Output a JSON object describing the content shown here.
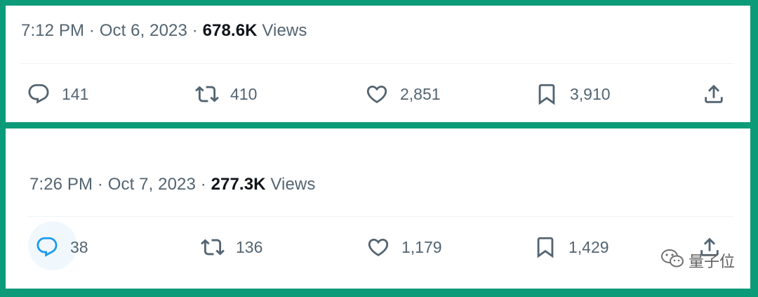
{
  "tweets": [
    {
      "time": "7:12 PM",
      "date": "Oct 6, 2023",
      "views_count": "678.6K",
      "views_label": "Views",
      "separator": "·",
      "replies": "141",
      "retweets": "410",
      "likes": "2,851",
      "bookmarks": "3,910"
    },
    {
      "time": "7:26 PM",
      "date": "Oct 7, 2023",
      "views_count": "277.3K",
      "views_label": "Views",
      "separator": "·",
      "replies": "38",
      "retweets": "136",
      "likes": "1,179",
      "bookmarks": "1,429"
    }
  ],
  "icons": {
    "reply": "reply-icon",
    "retweet": "retweet-icon",
    "like": "heart-icon",
    "bookmark": "bookmark-icon",
    "share": "share-icon"
  },
  "colors": {
    "frame": "#0c9b78",
    "muted_text": "#536471",
    "strong_text": "#0f1419",
    "reply_hover": "#1d9bf0"
  },
  "watermark": {
    "text": "量子位"
  }
}
